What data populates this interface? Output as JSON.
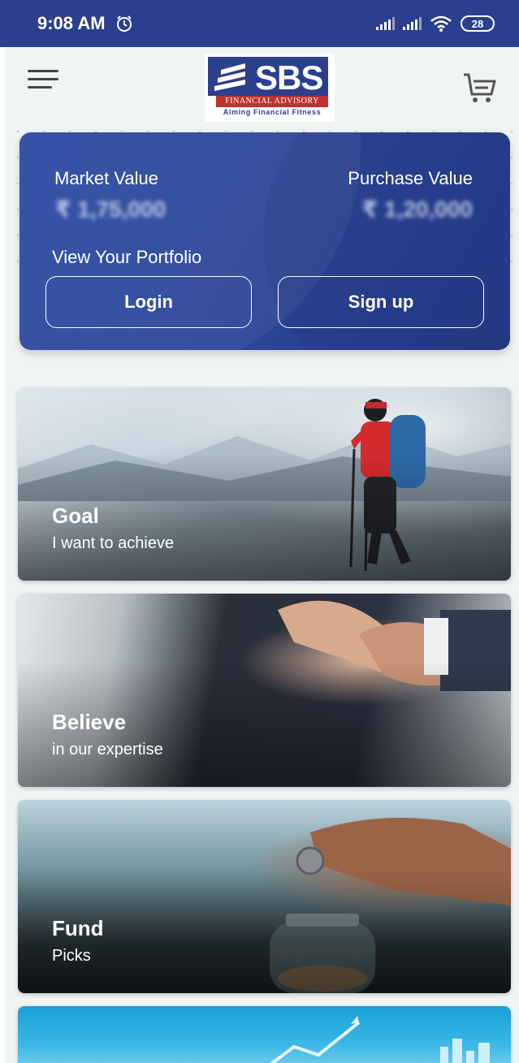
{
  "status": {
    "time": "9:08 AM",
    "battery": "28"
  },
  "header": {
    "logo": {
      "brand": "SBS",
      "subtitle": "FINANCIAL ADVISORY",
      "tagline": "Aiming Financial Fitness"
    }
  },
  "portfolio": {
    "market_label": "Market Value",
    "market_value": "₹ 1,75,000",
    "purchase_label": "Purchase Value",
    "purchase_value": "₹ 1,20,000",
    "view_label": "View Your Portfolio",
    "login_label": "Login",
    "signup_label": "Sign up",
    "accent": "#2c3f8f"
  },
  "cards": [
    {
      "title": "Goal",
      "subtitle": "I want to achieve"
    },
    {
      "title": "Believe",
      "subtitle": "in our expertise"
    },
    {
      "title": "Fund",
      "subtitle": "Picks"
    }
  ]
}
